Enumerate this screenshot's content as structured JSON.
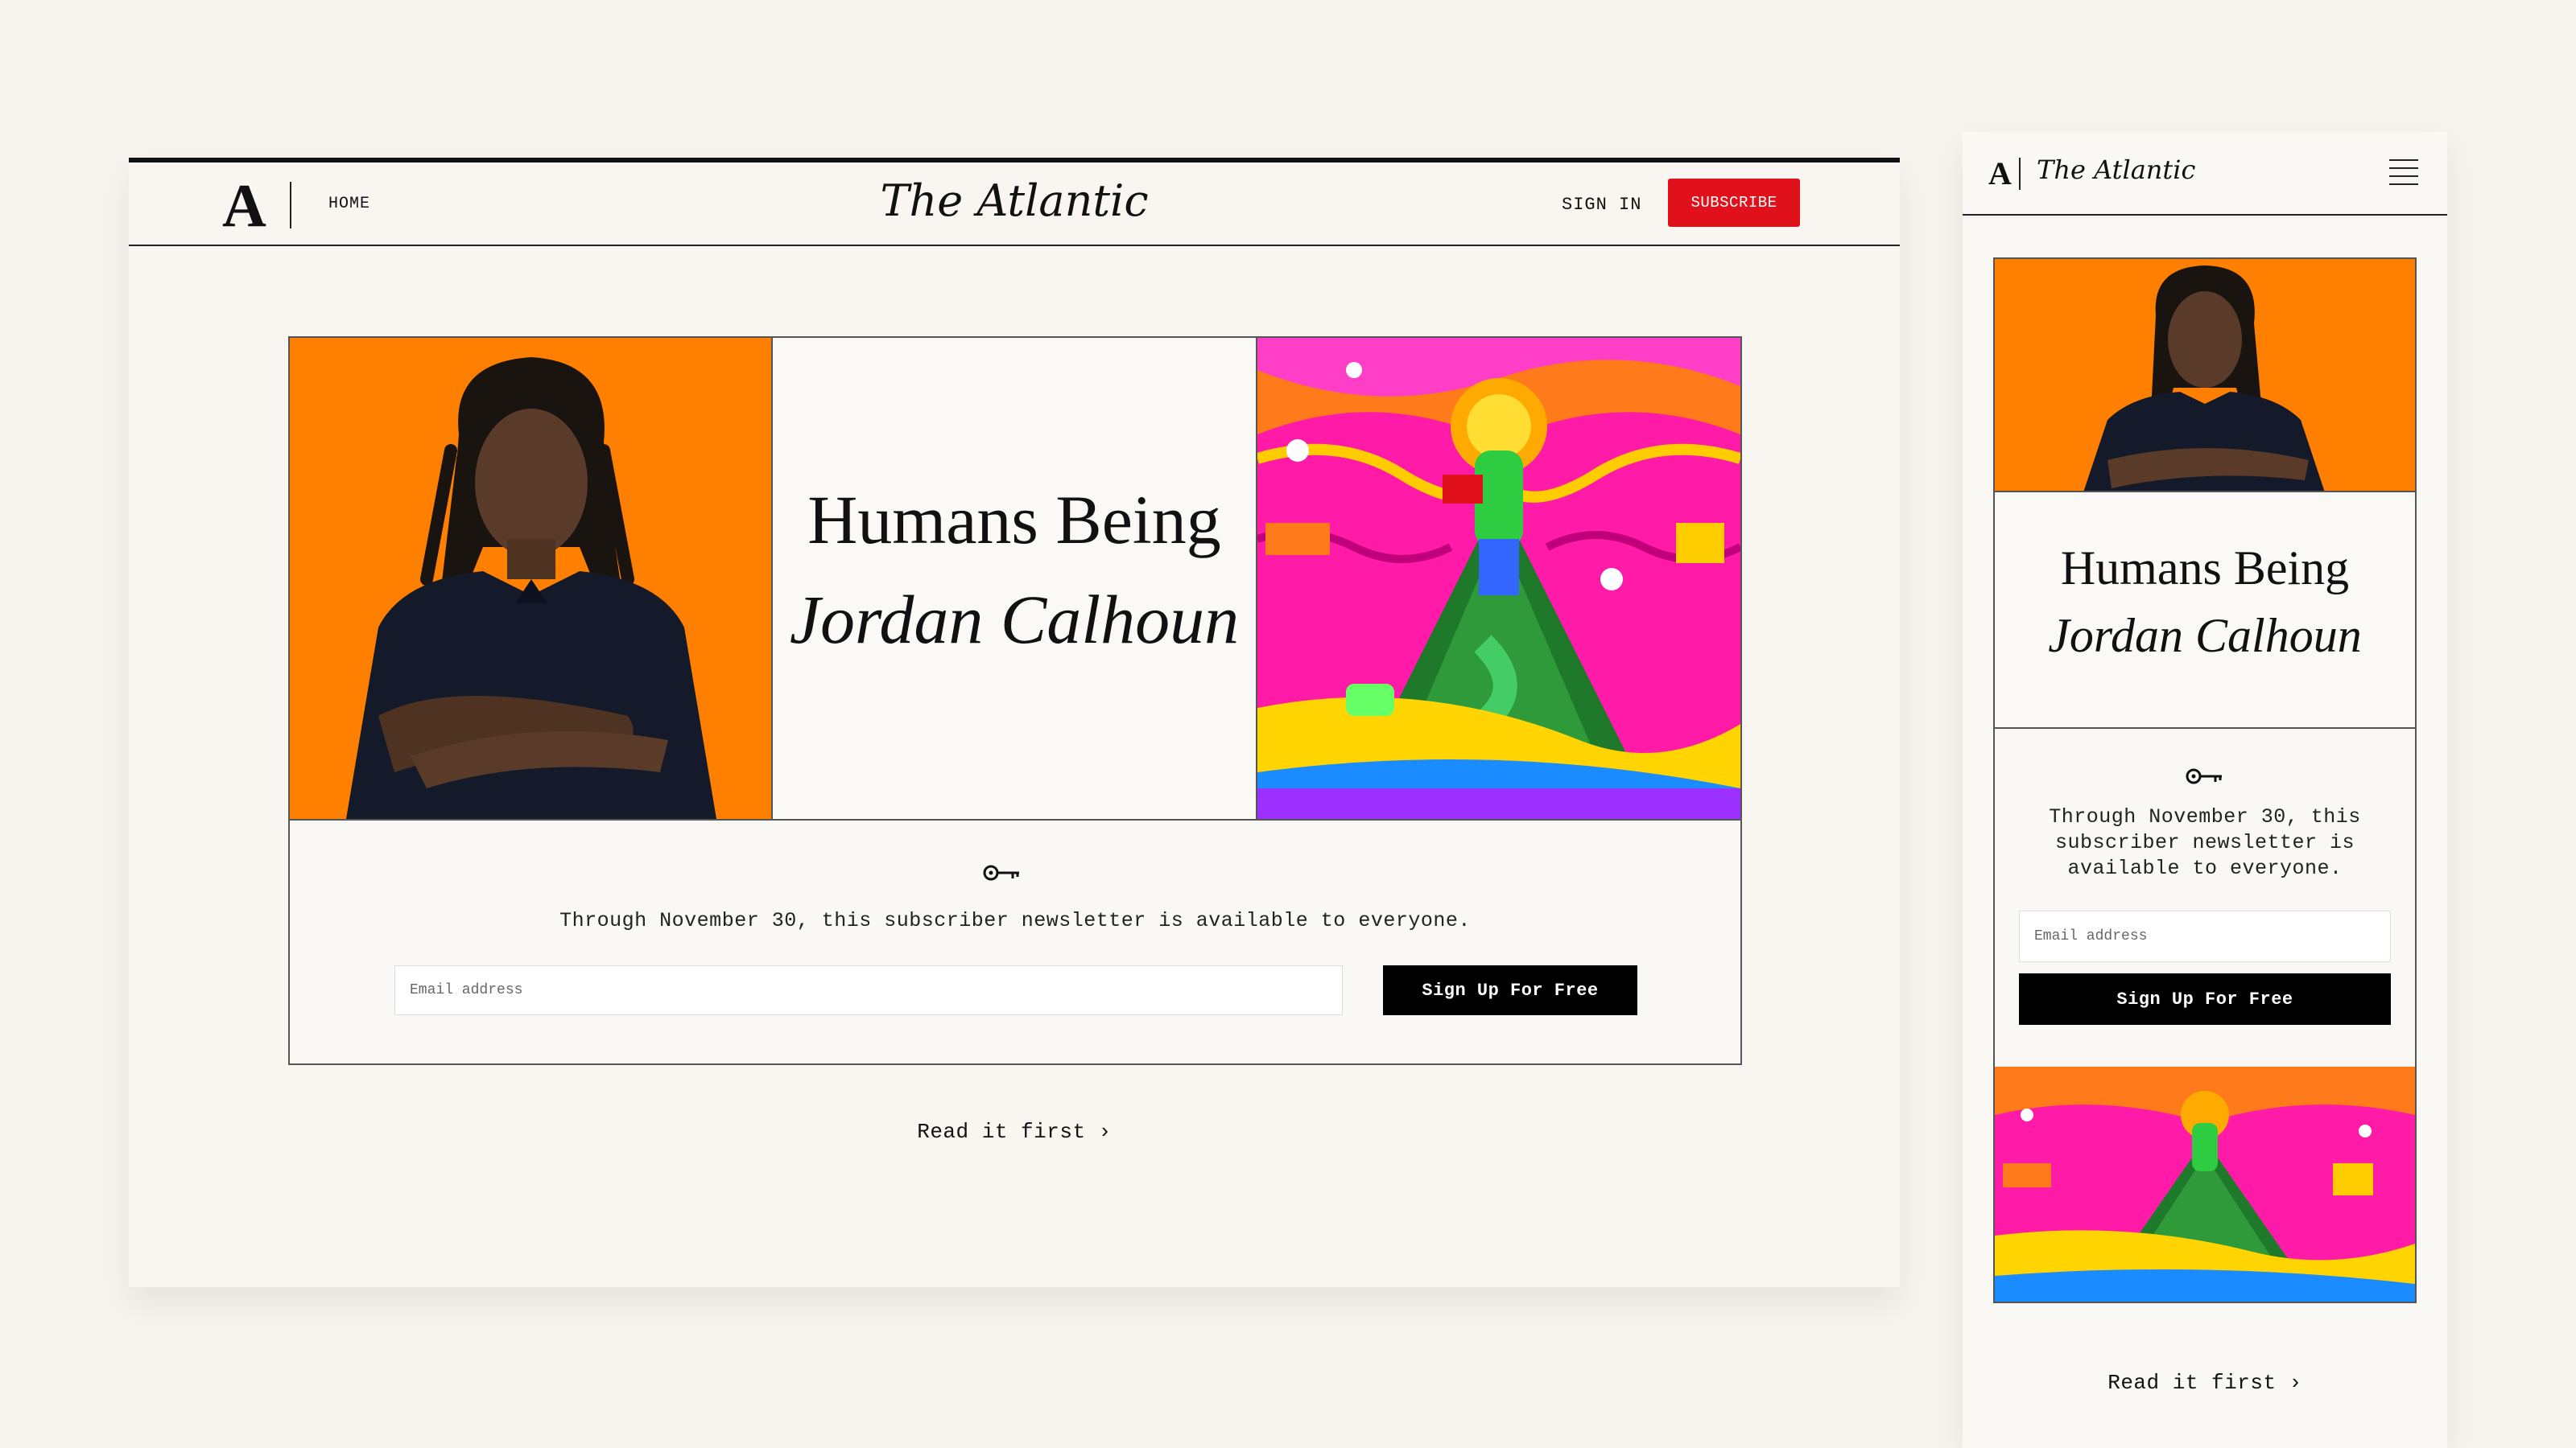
{
  "brand": {
    "logo_letter": "A",
    "name": "The Atlantic",
    "accent": "#e0111b",
    "photo_bg": "#ff7f00"
  },
  "desktop": {
    "nav": {
      "home_label": "HOME",
      "signin_label": "SIGN IN",
      "subscribe_label": "SUBSCRIBE"
    },
    "hero": {
      "title_line1": "Humans Being",
      "title_line2": "Jordan Calhoun"
    },
    "signup": {
      "message": "Through November 30, this subscriber newsletter is available to everyone.",
      "email_placeholder": "Email address",
      "button_label": "Sign Up For Free"
    },
    "read_link": "Read it first ›"
  },
  "mobile": {
    "hero": {
      "title_line1": "Humans Being",
      "title_line2": "Jordan Calhoun"
    },
    "signup": {
      "message": "Through November 30, this subscriber newsletter is available to everyone.",
      "email_placeholder": "Email address",
      "button_label": "Sign Up For Free"
    },
    "read_link": "Read it first ›"
  },
  "icons": [
    "key-icon",
    "hamburger-menu-icon",
    "chevron-right-icon"
  ]
}
